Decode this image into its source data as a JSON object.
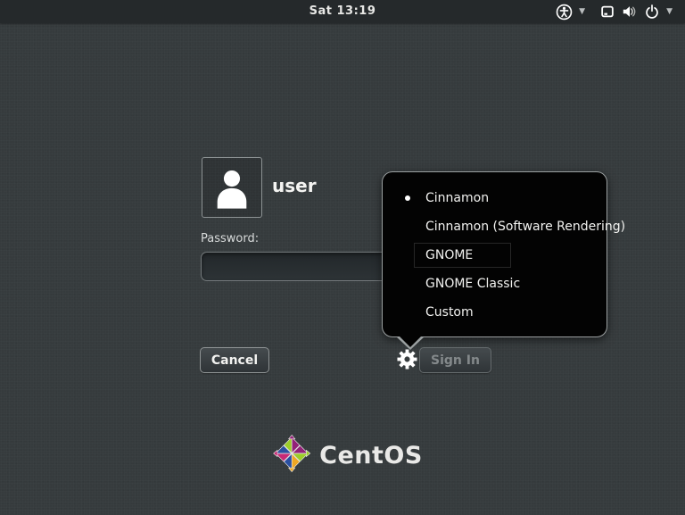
{
  "top_bar": {
    "clock": "Sat 13:19",
    "icons": {
      "chevron_glyph": "▼"
    }
  },
  "login": {
    "username": "user",
    "password_label": "Password:",
    "password_value": "",
    "cancel_label": "Cancel",
    "sign_in_label": "Sign In",
    "sign_in_enabled": false
  },
  "session_menu": {
    "items": [
      {
        "label": "Cinnamon",
        "selected": true
      },
      {
        "label": "Cinnamon (Software Rendering)",
        "selected": false
      },
      {
        "label": "GNOME",
        "selected": false,
        "focused": true
      },
      {
        "label": "GNOME Classic",
        "selected": false
      },
      {
        "label": "Custom",
        "selected": false
      }
    ]
  },
  "footer": {
    "brand": "CentOS"
  },
  "colors": {
    "background": "#363b3d",
    "top_bar": "#25292b",
    "popup_background": "#030303",
    "popup_border": "#9ba0a1",
    "text": "#f2f2f0",
    "disabled_text": "#84898b",
    "centos_purple": "#932279",
    "centos_green": "#9ccd2a",
    "centos_orange": "#efa724",
    "centos_blue": "#2b50a1",
    "centos_magenta": "#c72a76"
  }
}
